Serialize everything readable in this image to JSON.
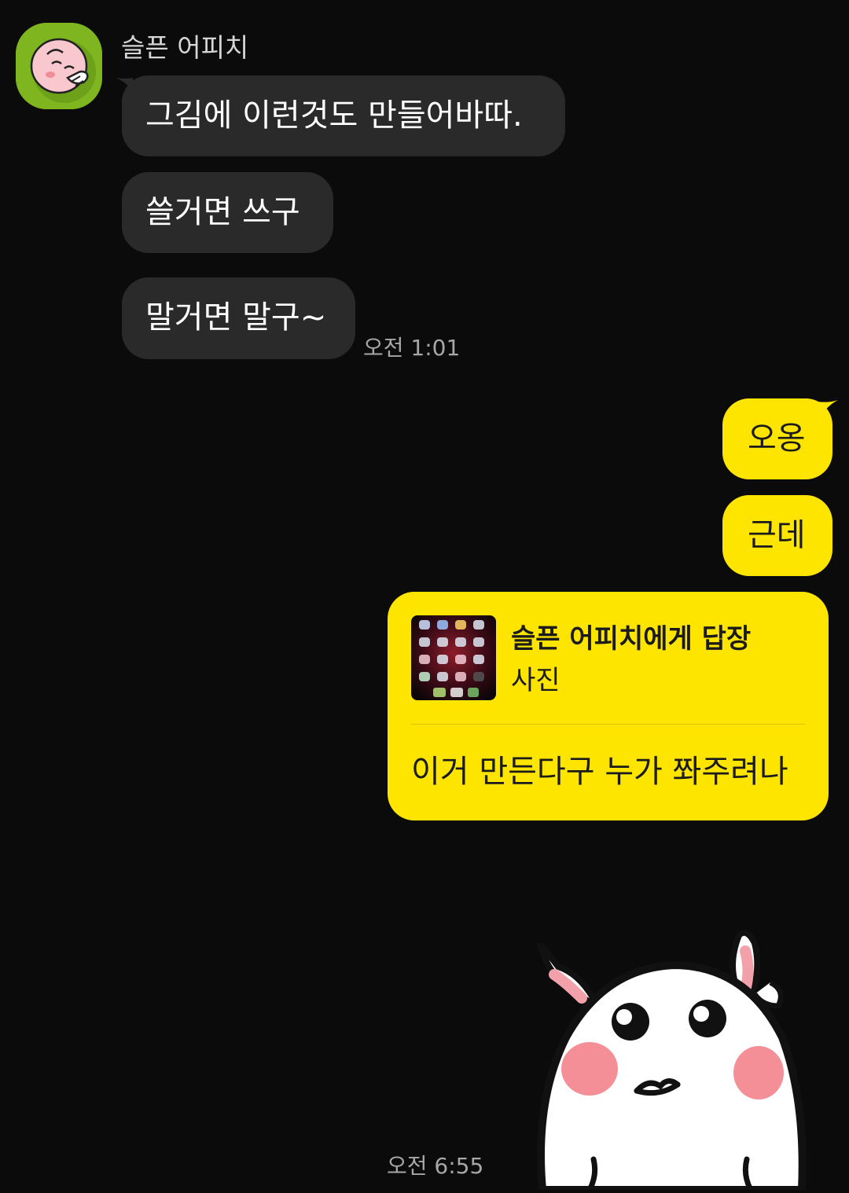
{
  "sender": {
    "name": "슬픈 어피치",
    "avatar_color": "#7fb51e"
  },
  "incoming_messages": [
    {
      "text": "그김에 이런것도 만들어바따."
    },
    {
      "text": "쓸거면 쓰구"
    },
    {
      "text": "말거면 말구~"
    }
  ],
  "incoming_time": "오전 1:01",
  "outgoing_messages": [
    {
      "text": "오옹"
    },
    {
      "text": "근데"
    }
  ],
  "reply": {
    "title": "슬픈 어피치에게 답장",
    "subtitle": "사진",
    "body": "이거 만든다구 누가 쫘주려나"
  },
  "outgoing_time": "오전 6:55",
  "colors": {
    "background": "#0b0b0b",
    "incoming_bubble": "#2a2a2a",
    "outgoing_bubble": "#fee500"
  },
  "sticker": {
    "icon": "white-rabbit-sticker-icon"
  }
}
